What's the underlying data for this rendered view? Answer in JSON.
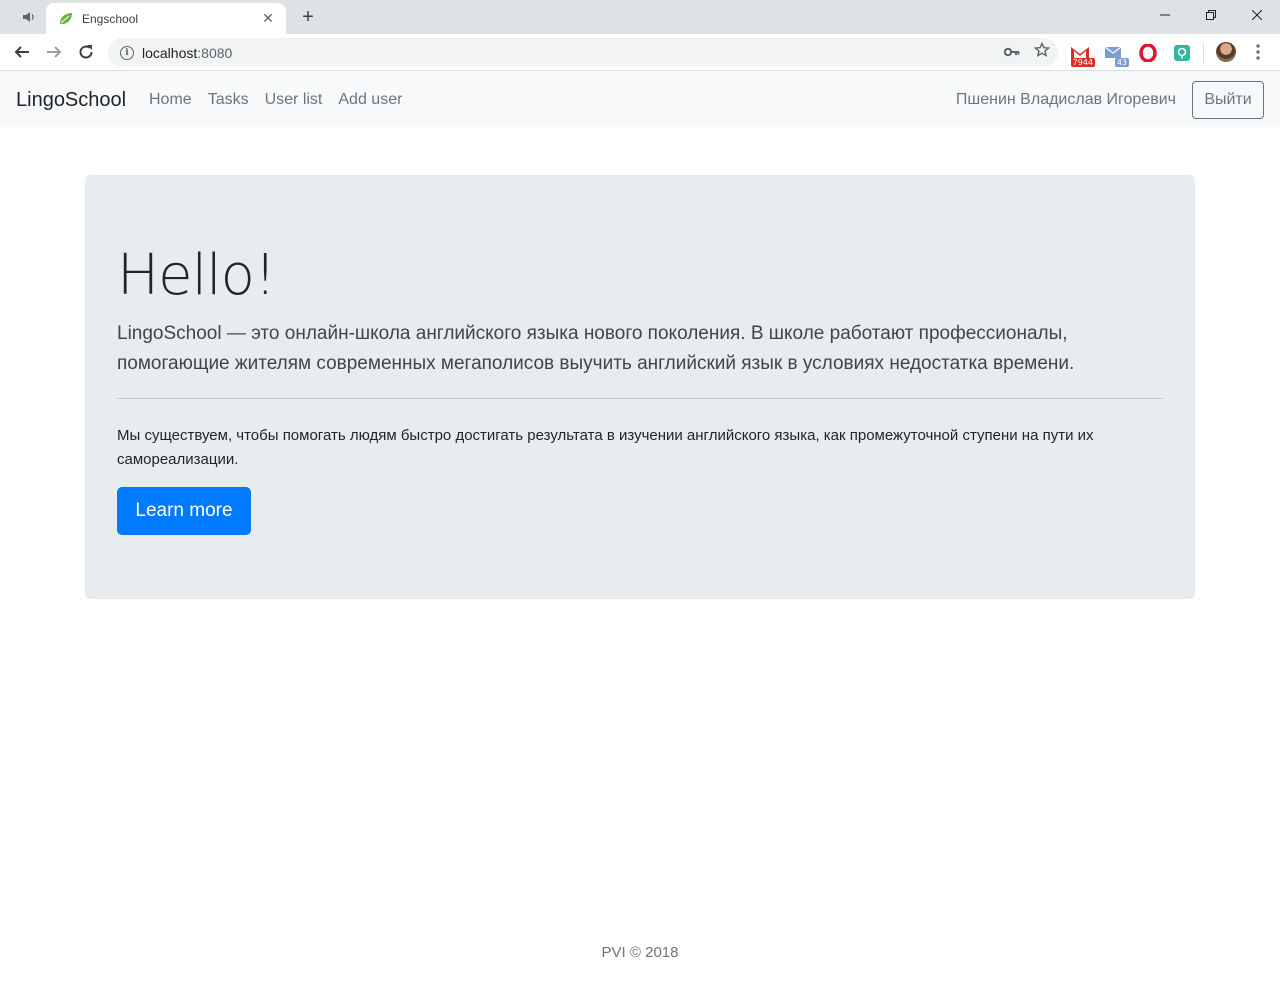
{
  "browser": {
    "tab_title": "Engschool",
    "url_host": "localhost",
    "url_port": ":8080",
    "extensions": [
      {
        "name": "gmail-extension",
        "badge": "7944",
        "badge_color": "#d93025"
      },
      {
        "name": "mail-extension",
        "badge": "43",
        "badge_color": "#7b9bd1"
      },
      {
        "name": "opera-extension"
      },
      {
        "name": "green-extension"
      }
    ]
  },
  "navbar": {
    "brand": "LingoSchool",
    "links": [
      "Home",
      "Tasks",
      "User list",
      "Add user"
    ],
    "user_name": "Пшенин Владислав Игоревич",
    "logout_label": "Выйти"
  },
  "jumbotron": {
    "title": "Hello!",
    "lead": "LingoSchool — это онлайн-школа английского языка нового поколения. В школе работают профессионалы, помогающие жителям современных мегаполисов выучить английский язык в условиях недостатка времени.",
    "text": "Мы существуем, чтобы помогать людям быстро достигать результата в изучении английского языка, как промежуточной ступени на пути их самореализации.",
    "button_label": "Learn more"
  },
  "footer": {
    "text": "PVI © 2018"
  },
  "colors": {
    "primary": "#007bff",
    "navbar_bg": "#f8f9fa",
    "jumbotron_bg": "#e9ecef",
    "muted": "#6c757d"
  }
}
